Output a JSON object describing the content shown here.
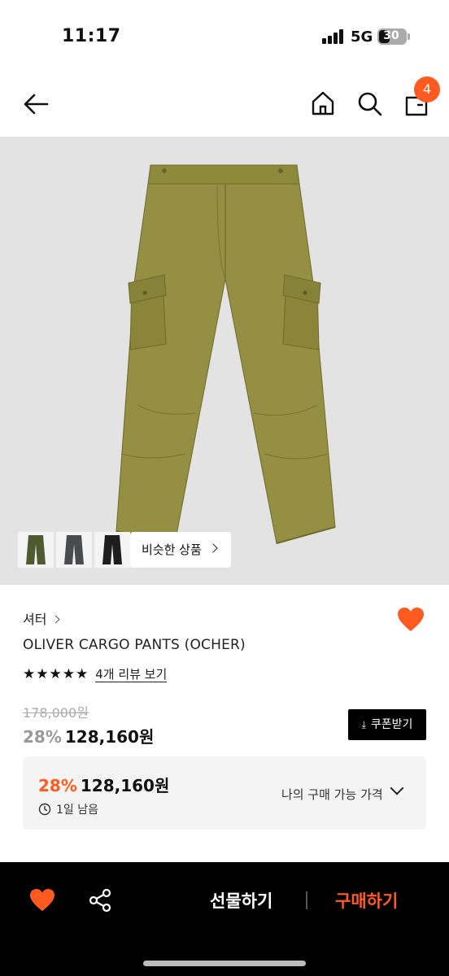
{
  "status_bar": {
    "time": "11:17",
    "network": "5G",
    "battery": "30"
  },
  "header": {
    "cart_count": "4"
  },
  "hero": {
    "similar_label": "비슷한 상품"
  },
  "product": {
    "brand": "셔터",
    "title": "OLIVER CARGO PANTS (OCHER)",
    "stars": "★★★★★",
    "review_link": "4개 리뷰 보기",
    "original_price": "178,000원",
    "discount_rate": "28%",
    "sale_price": "128,160원",
    "coupon_label": "쿠폰받기"
  },
  "my_price": {
    "discount_rate": "28%",
    "price": "128,160원",
    "remaining": "1일 남음",
    "label": "나의 구매 가능 가격"
  },
  "bottom_bar": {
    "gift_label": "선물하기",
    "buy_label": "구매하기"
  },
  "colors": {
    "accent": "#ff5a1f",
    "pants": "#8e8a3c"
  }
}
